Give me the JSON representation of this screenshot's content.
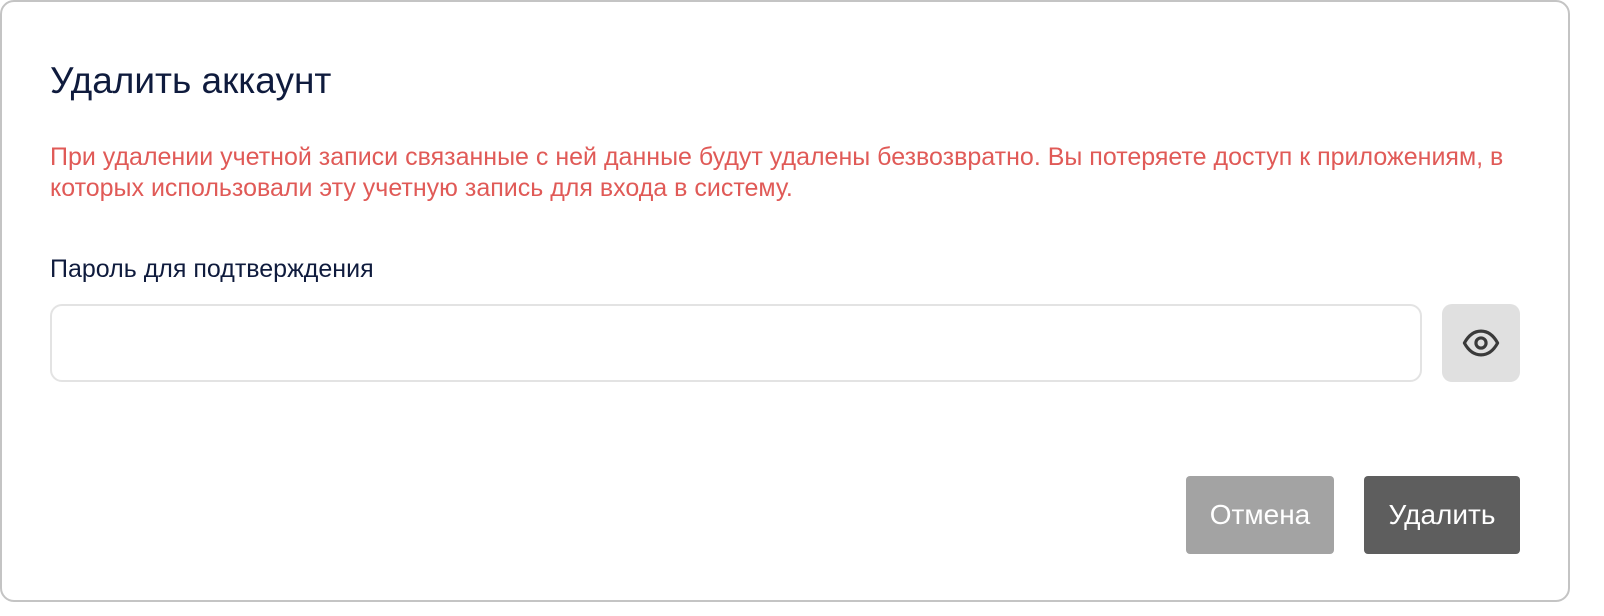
{
  "dialog": {
    "title": "Удалить аккаунт",
    "warning": "При удалении учетной записи связанные с ней данные будут удалены безвозвратно. Вы потеряете доступ к приложениям, в которых использовали эту учетную запись для входа в систему.",
    "password_label": "Пароль для подтверждения",
    "password_value": "",
    "password_placeholder": "",
    "toggle_visibility_icon": "eye-icon",
    "cancel_label": "Отмена",
    "delete_label": "Удалить"
  },
  "colors": {
    "title": "#0f1b3d",
    "warning": "#e05a57",
    "cancel_button": "#a3a3a3",
    "delete_button": "#5e5e5e",
    "eye_button": "#e0e0e0"
  }
}
